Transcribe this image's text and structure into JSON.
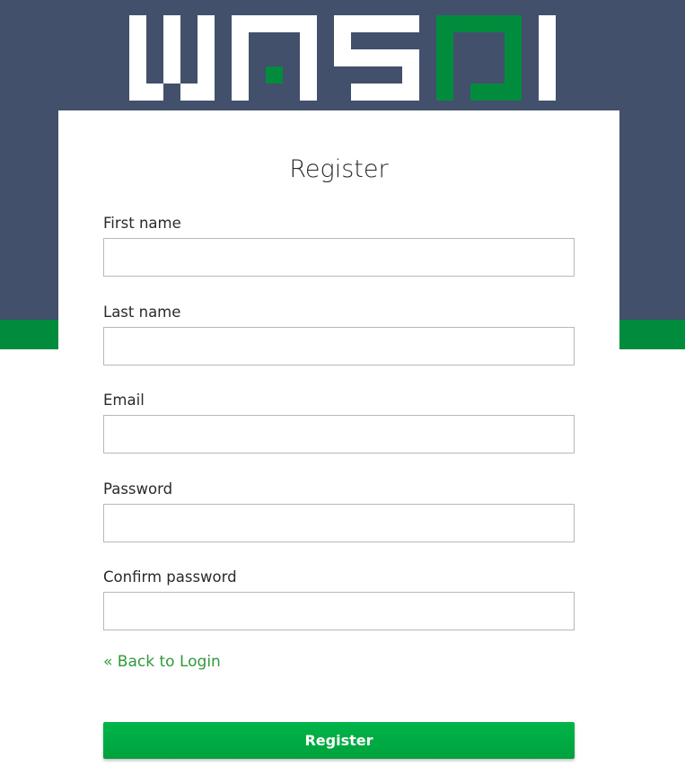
{
  "brand": {
    "logo_text": "WASDI",
    "header_color": "#42506b",
    "accent_color": "#008c3c"
  },
  "form": {
    "title": "Register",
    "fields": [
      {
        "label": "First name",
        "value": "",
        "type": "text"
      },
      {
        "label": "Last name",
        "value": "",
        "type": "text"
      },
      {
        "label": "Email",
        "value": "",
        "type": "email"
      },
      {
        "label": "Password",
        "value": "",
        "type": "password"
      },
      {
        "label": "Confirm password",
        "value": "",
        "type": "password"
      }
    ],
    "back_link": "« Back to Login",
    "submit_label": "Register"
  }
}
